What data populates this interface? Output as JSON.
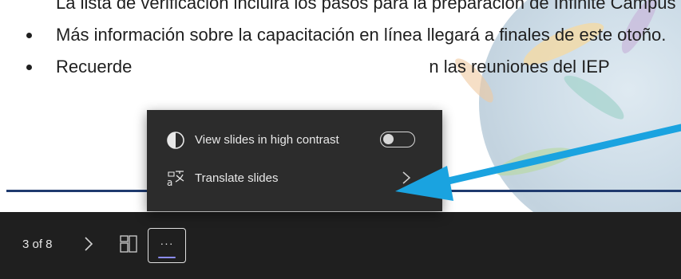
{
  "slide": {
    "bullets": [
      "La lista de verificación incluirá los pasos para la preparación de Infinite Campus",
      "Más información sobre la capacitación en línea llegará a finales de este otoño.",
      "Recuerde n las reuniones del IEP"
    ],
    "bullet3_left": "Recuerde",
    "bullet3_right": "n las reuniones del IEP"
  },
  "menu": {
    "items": [
      {
        "label": "View slides in high contrast",
        "icon": "contrast-icon",
        "toggle_on": false
      },
      {
        "label": "Translate slides",
        "icon": "translate-icon"
      }
    ]
  },
  "toolbar": {
    "counter": "3 of 8",
    "next_icon": "chevron-right-icon",
    "grid_icon": "slide-grid-icon",
    "more_label": "···"
  },
  "colors": {
    "toolbar_bg": "#1f1f1f",
    "menu_bg": "#2c2c2c",
    "arrow": "#1aa3e0",
    "accent_underline": "#8b8cf6",
    "rule": "#1f3a6e"
  }
}
